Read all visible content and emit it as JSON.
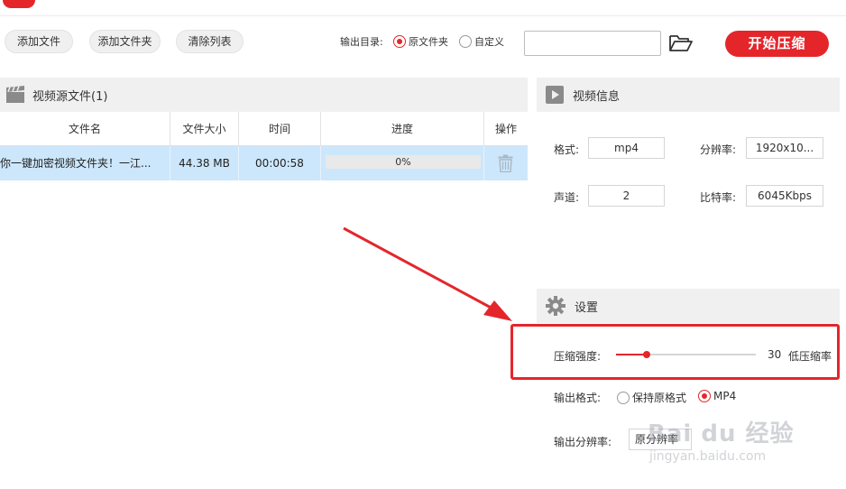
{
  "toolbar": {
    "add_file": "添加文件",
    "add_folder": "添加文件夹",
    "clear_list": "清除列表",
    "output_dir_label": "输出目录:",
    "radio_original": "原文件夹",
    "radio_custom": "自定义",
    "path_value": "",
    "start_label": "开始压缩"
  },
  "source_panel": {
    "title": "视频源文件(1)",
    "columns": [
      "文件名",
      "文件大小",
      "时间",
      "进度",
      "操作"
    ],
    "rows": [
      {
        "name": "教你一键加密视频文件夹！一江...",
        "size": "44.38 MB",
        "time": "00:00:58",
        "progress": "0%",
        "progress_value": 0
      }
    ]
  },
  "info_panel": {
    "title": "视频信息",
    "format_label": "格式:",
    "format_value": "mp4",
    "resolution_label": "分辨率:",
    "resolution_value": "1920x10...",
    "channel_label": "声道:",
    "channel_value": "2",
    "bitrate_label": "比特率:",
    "bitrate_value": "6045Kbps"
  },
  "settings_panel": {
    "title": "设置",
    "strength_label": "压缩强度:",
    "strength_value": "30",
    "strength_fraction": 0.22,
    "strength_desc": "低压缩率",
    "output_format_label": "输出格式:",
    "format_keep": "保持原格式",
    "format_mp4": "MP4",
    "output_res_label": "输出分辨率:",
    "output_res_value": "原分辨率"
  },
  "watermark": {
    "brand": "Bai du 经验",
    "url": "jingyan.baidu.com"
  },
  "colors": {
    "accent": "#e4262b",
    "row_selected": "#cce7fb",
    "header_bg": "#f0f0f0"
  }
}
